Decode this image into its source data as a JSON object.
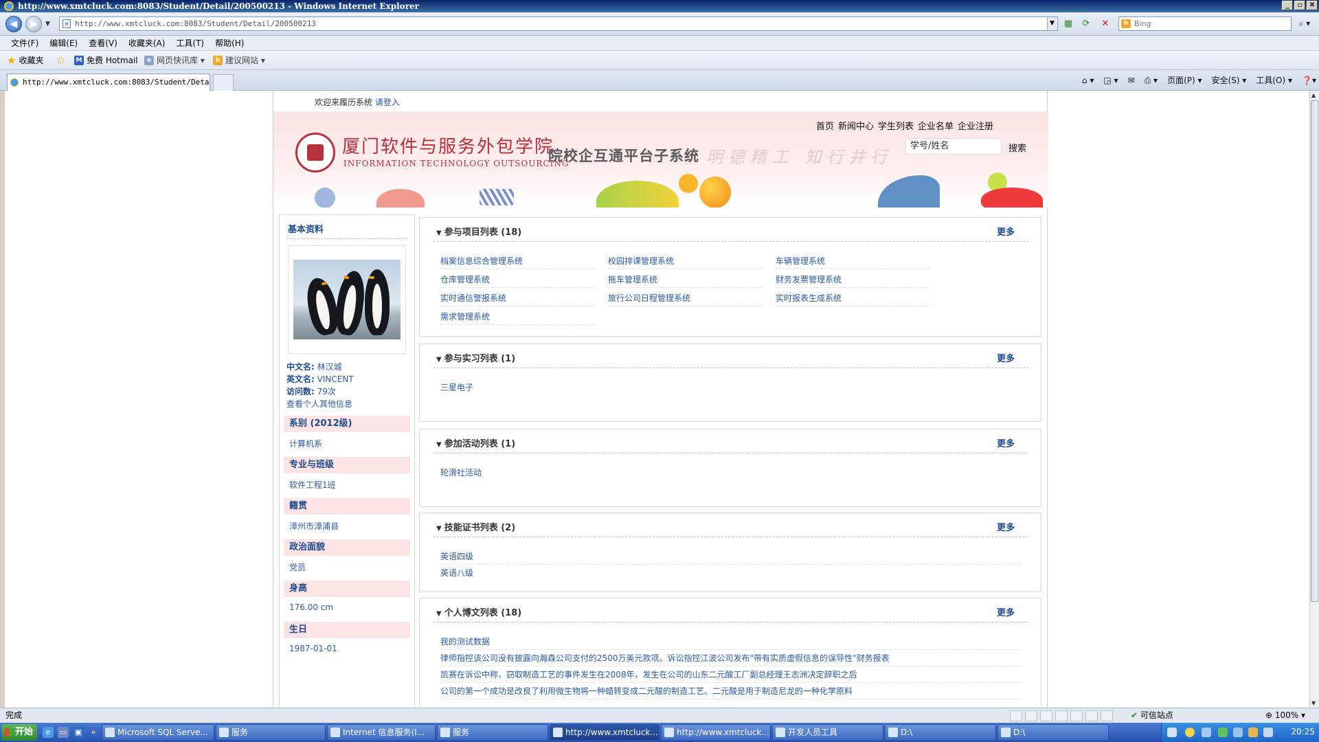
{
  "window": {
    "title": "http://www.xmtcluck.com:8083/Student/Detail/200500213 - Windows Internet Explorer"
  },
  "address_bar": {
    "url": "http://www.xmtcluck.com:8083/Student/Detail/200500213",
    "search_placeholder": "Bing"
  },
  "menu": [
    "文件(F)",
    "编辑(E)",
    "查看(V)",
    "收藏夹(A)",
    "工具(T)",
    "帮助(H)"
  ],
  "favorites_bar": {
    "favorites_label": "收藏夹",
    "items": [
      "免费 Hotmail",
      "网页快讯库 ▾",
      "建议网站 ▾"
    ]
  },
  "tabs": {
    "active_label": "http://www.xmtcluck.com:8083/Student/Deta..."
  },
  "command_bar": [
    "页面(P) ▾",
    "安全(S) ▾",
    "工具(O) ▾"
  ],
  "page": {
    "welcome": "欢迎来履历系统",
    "login_link": "请登入",
    "nav": [
      "首页",
      "新闻中心",
      "学生列表",
      "企业名单",
      "企业注册"
    ],
    "school_name": "厦门软件与服务外包学院",
    "school_name_en": "INFORMATION TECHNOLOGY OUTSOURCING",
    "platform_name": "院校企互通平台子系统",
    "motto": "明德精工 知行并行",
    "search_placeholder": "学号/姓名",
    "search_button": "搜索",
    "left": {
      "title": "基本资料",
      "chinese_name_label": "中文名:",
      "chinese_name": "林汉城",
      "english_name_label": "英文名:",
      "english_name": "VINCENT",
      "visits_label": "访问数:",
      "visits": "79次",
      "other_info_link": "查看个人其他信息",
      "sections": [
        {
          "header": "系别 (2012级)",
          "value": "计算机系"
        },
        {
          "header": "专业与班级",
          "value": "软件工程1班"
        },
        {
          "header": "籍贯",
          "value": "漳州市漳浦县"
        },
        {
          "header": "政治面貌",
          "value": "党员"
        },
        {
          "header": "身高",
          "value": "176.00 cm"
        },
        {
          "header": "生日",
          "value": "1987-01-01"
        }
      ]
    },
    "more_label": "更多",
    "panels": {
      "projects": {
        "title": "参与项目列表 (18)",
        "items": [
          "档案信息综合管理系统",
          "校园排课管理系统",
          "车辆管理系统",
          "仓库管理系统",
          "拖车管理系统",
          "财务发票管理系统",
          "实时通信警报系统",
          "旅行公司日程管理系统",
          "实时报表生成系统",
          "需求管理系统"
        ]
      },
      "internships": {
        "title": "参与实习列表 (1)",
        "items": [
          "三星电子"
        ]
      },
      "activities": {
        "title": "参加活动列表 (1)",
        "items": [
          "轮滑社活动"
        ]
      },
      "certificates": {
        "title": "技能证书列表 (2)",
        "items": [
          "英语四级",
          "英语八级"
        ]
      },
      "blogs": {
        "title": "个人博文列表 (18)",
        "items": [
          "我的测试数据",
          "律师指控该公司没有披露向瀚森公司支付的2500万美元款项。诉讼指控江波公司发布\"带有实质虚假信息的误导性\"财务报表",
          "凯赛在诉讼中称，窃取制造工艺的事件发生在2008年，发生在公司的山东二元酸工厂副总经理王志洲决定辞职之后",
          "公司的第一个成功是改良了利用微生物将一种蜡转变成二元酸的制造工艺。二元酸是用于制造尼龙的一种化学原料"
        ]
      }
    }
  },
  "status_bar": {
    "status": "完成",
    "zone": "可信站点",
    "zoom": "100%"
  },
  "taskbar": {
    "start": "开始",
    "tasks": [
      "Microsoft SQL Serve...",
      "服务",
      "Internet 信息服务(I...",
      "服务",
      "http://www.xmtcluck...",
      "http://www.xmtcluck...",
      "开发人员工具",
      "D:\\",
      "D:\\"
    ],
    "clock": "20:25"
  }
}
